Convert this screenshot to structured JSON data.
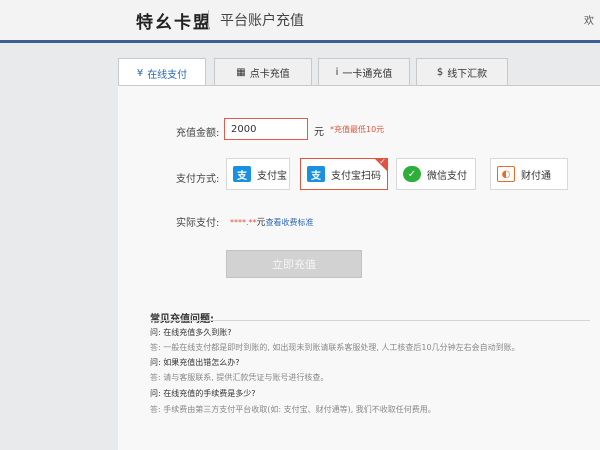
{
  "header": {
    "logo_text": "特幺卡盟",
    "page_title": "平台账户充值",
    "corner_text": "欢"
  },
  "tabs": [
    {
      "icon": "¥",
      "label": "在线支付",
      "active": true
    },
    {
      "icon": "▦",
      "label": "点卡充值",
      "active": false
    },
    {
      "icon": "ⅰ",
      "label": "一卡通充值",
      "active": false
    },
    {
      "icon": "$",
      "label": "线下汇款",
      "active": false
    }
  ],
  "form": {
    "amount_label": "充值金额:",
    "amount_value": "2000",
    "amount_unit": "元",
    "amount_hint": "*充值最低10元",
    "method_label": "支付方式:",
    "actual_label": "实际支付:",
    "actual_value": "****.**",
    "actual_unit": "元",
    "actual_link": "查看收费标准",
    "submit_label": "立即充值"
  },
  "payment_methods": [
    {
      "icon": "支",
      "label": "支付宝",
      "color": "#1b8fe0",
      "selected": false
    },
    {
      "icon": "支",
      "label": "支付宝扫码",
      "color": "#1b8fe0",
      "selected": true
    },
    {
      "icon": "✓",
      "label": "微信支付",
      "color": "#2fae3c",
      "selected": false
    },
    {
      "icon": "◐",
      "label": "财付通",
      "color": "#e86b2b",
      "selected": false
    }
  ],
  "faq": {
    "title": "常见充值问题:",
    "rows": [
      {
        "type": "q",
        "text": "问: 在线充值多久到账?"
      },
      {
        "type": "a",
        "text": "答: 一般在线支付都是即时到账的, 如出现未到账请联系客服处理, 人工核查后10几分钟左右会自动到账。"
      },
      {
        "type": "q",
        "text": "问: 如果充值出错怎么办?"
      },
      {
        "type": "a",
        "text": "答: 请与客服联系, 提供汇款凭证与账号进行核查。"
      },
      {
        "type": "q",
        "text": "问: 在线充值的手续费是多少?"
      },
      {
        "type": "a",
        "text": "答: 手续费由第三方支付平台收取(如: 支付宝、财付通等), 我们不收取任何费用。"
      }
    ]
  }
}
